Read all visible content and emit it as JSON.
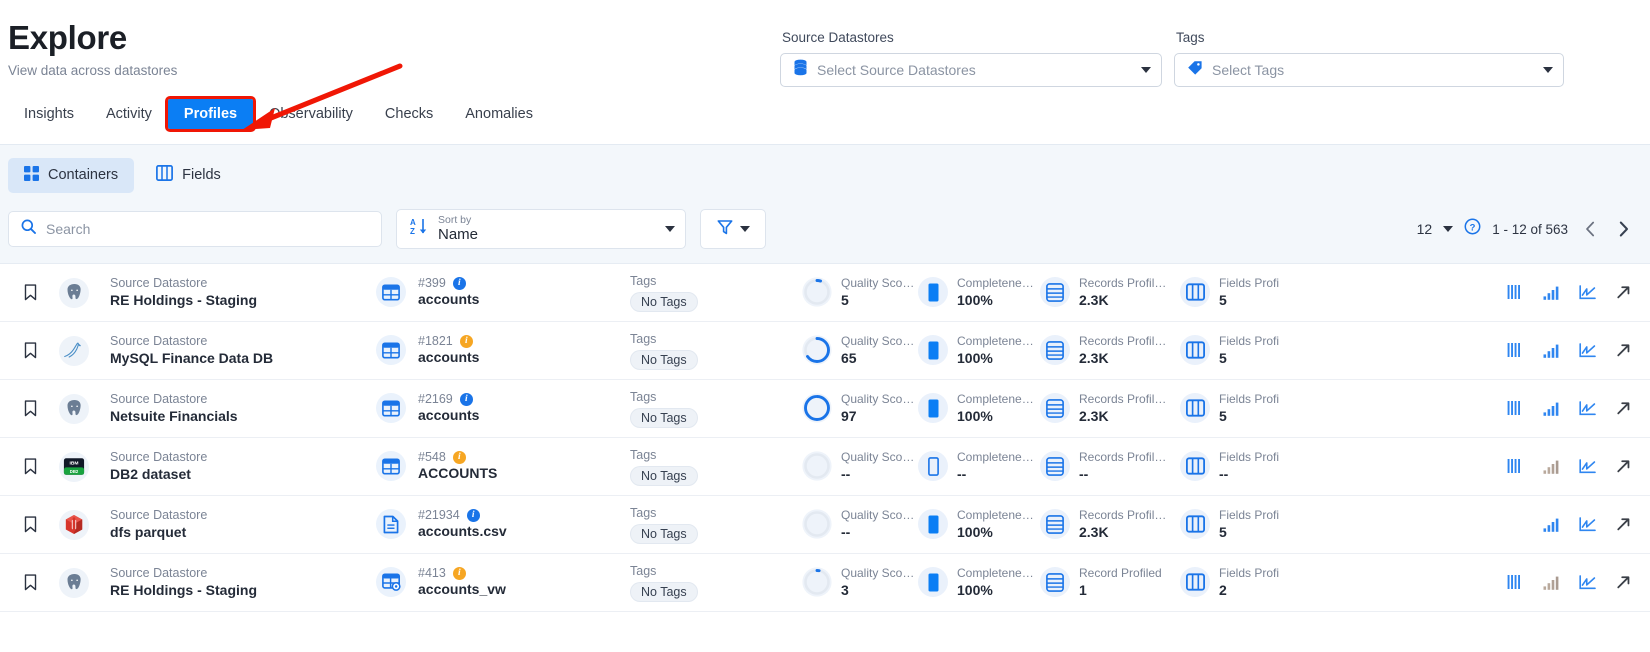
{
  "header": {
    "title": "Explore",
    "subtitle": "View data across datastores"
  },
  "top_filters": {
    "source_datastores": {
      "label": "Source Datastores",
      "placeholder": "Select Source Datastores",
      "icon": "database-icon"
    },
    "tags": {
      "label": "Tags",
      "placeholder": "Select Tags",
      "icon": "tag-icon"
    }
  },
  "tabs": [
    {
      "label": "Insights",
      "active": false
    },
    {
      "label": "Activity",
      "active": false
    },
    {
      "label": "Profiles",
      "active": true
    },
    {
      "label": "Observability",
      "active": false
    },
    {
      "label": "Checks",
      "active": false
    },
    {
      "label": "Anomalies",
      "active": false
    }
  ],
  "segments": [
    {
      "label": "Containers",
      "icon": "grid-icon",
      "active": true
    },
    {
      "label": "Fields",
      "icon": "columns-icon",
      "active": false
    }
  ],
  "toolbar": {
    "search_placeholder": "Search",
    "sort_label": "Sort by",
    "sort_value": "Name",
    "filter_icon": "funnel-icon"
  },
  "pagination": {
    "page_size": "12",
    "range": "1 - 12 of 563",
    "help_icon": "question-circle-icon",
    "prev_icon": "chevron-left-icon",
    "next_icon": "chevron-right-icon"
  },
  "colors": {
    "accent": "#0b7ef4",
    "annotation": "#f01705",
    "band": "#f3f7fb",
    "badge_blue": "#1a74e8",
    "badge_amber": "#f6a623"
  },
  "row_labels": {
    "source_datastore": "Source Datastore",
    "tags": "Tags",
    "quality_score": "Quality Sco…",
    "completeness": "Completene…",
    "records_profiled": "Records Profil…",
    "records_profiled_single": "Record Profiled",
    "fields_profiled": "Fields Profi"
  },
  "rows": [
    {
      "datastore_name": "RE Holdings - Staging",
      "datastore_logo": "postgresql-icon",
      "object_id": "#399",
      "object_name": "accounts",
      "object_icon": "table-icon",
      "badge": "blue",
      "tags": "No Tags",
      "quality_score": "5",
      "quality_ring_pct": 5,
      "completeness": "100%",
      "completeness_fill": "full",
      "records_profiled": "2.3K",
      "fields_profiled": "5",
      "actions": [
        "bars-icon",
        "bar-chart-icon",
        "line-chart-icon",
        "external-link-icon"
      ]
    },
    {
      "datastore_name": "MySQL Finance Data DB",
      "datastore_logo": "mysql-icon",
      "object_id": "#1821",
      "object_name": "accounts",
      "object_icon": "table-icon",
      "badge": "amber",
      "tags": "No Tags",
      "quality_score": "65",
      "quality_ring_pct": 65,
      "completeness": "100%",
      "completeness_fill": "full",
      "records_profiled": "2.3K",
      "fields_profiled": "5",
      "actions": [
        "bars-icon",
        "bar-chart-icon",
        "line-chart-icon",
        "external-link-icon"
      ]
    },
    {
      "datastore_name": "Netsuite Financials",
      "datastore_logo": "postgresql-icon",
      "object_id": "#2169",
      "object_name": "accounts",
      "object_icon": "table-icon",
      "badge": "blue",
      "tags": "No Tags",
      "quality_score": "97",
      "quality_ring_pct": 97,
      "completeness": "100%",
      "completeness_fill": "full",
      "records_profiled": "2.3K",
      "fields_profiled": "5",
      "actions": [
        "bars-icon",
        "bar-chart-icon",
        "line-chart-icon",
        "external-link-icon"
      ]
    },
    {
      "datastore_name": "DB2 dataset",
      "datastore_logo": "db2-icon",
      "object_id": "#548",
      "object_name": "ACCOUNTS",
      "object_icon": "table-icon",
      "badge": "amber",
      "tags": "No Tags",
      "quality_score": "--",
      "quality_ring_pct": 0,
      "completeness": "--",
      "completeness_fill": "empty",
      "records_profiled": "--",
      "fields_profiled": "--",
      "actions": [
        "bars-icon",
        "bar-chart-icon-disabled",
        "line-chart-icon",
        "external-link-icon"
      ]
    },
    {
      "datastore_name": "dfs parquet",
      "datastore_logo": "parquet-icon",
      "object_id": "#21934",
      "object_name": "accounts.csv",
      "object_icon": "file-icon",
      "badge": "blue",
      "tags": "No Tags",
      "quality_score": "--",
      "quality_ring_pct": 0,
      "completeness": "100%",
      "completeness_fill": "full",
      "records_profiled": "2.3K",
      "fields_profiled": "5",
      "actions": [
        "",
        "bar-chart-icon",
        "line-chart-icon",
        "external-link-icon"
      ]
    },
    {
      "datastore_name": "RE Holdings - Staging",
      "datastore_logo": "postgresql-icon",
      "object_id": "#413",
      "object_name": "accounts_vw",
      "object_icon": "view-icon",
      "badge": "amber",
      "tags": "No Tags",
      "quality_score": "3",
      "quality_ring_pct": 3,
      "completeness": "100%",
      "completeness_fill": "full",
      "records_profiled": "1",
      "records_profiled_label_single": true,
      "fields_profiled": "2",
      "actions": [
        "bars-icon",
        "bar-chart-icon-disabled",
        "line-chart-icon",
        "external-link-icon"
      ]
    }
  ]
}
